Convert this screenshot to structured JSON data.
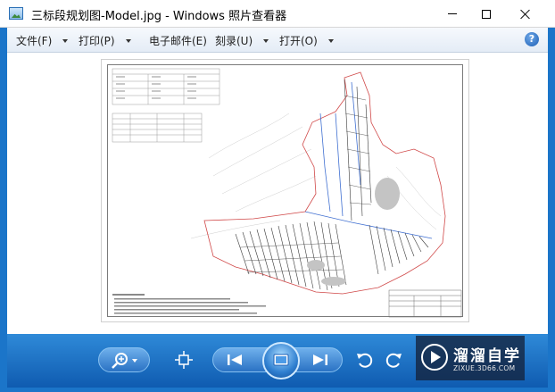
{
  "window": {
    "title": "三标段规划图-Model.jpg - Windows 照片查看器"
  },
  "menu": {
    "items": [
      {
        "label": "文件(F)",
        "has_dropdown": true
      },
      {
        "label": "打印(P)",
        "has_dropdown": true
      },
      {
        "label": "电子邮件(E)",
        "has_dropdown": false
      },
      {
        "label": "刻录(U)",
        "has_dropdown": true
      },
      {
        "label": "打开(O)",
        "has_dropdown": true
      }
    ],
    "help_label": "?"
  },
  "toolbar": {
    "buttons": [
      {
        "name": "zoom-button",
        "icon": "magnifier-icon"
      },
      {
        "name": "actual-size-button",
        "icon": "fit-window-icon"
      },
      {
        "name": "previous-button",
        "icon": "previous-icon"
      },
      {
        "name": "slideshow-button",
        "icon": "slideshow-icon"
      },
      {
        "name": "next-button",
        "icon": "next-icon"
      },
      {
        "name": "rotate-left-button",
        "icon": "rotate-ccw-icon"
      },
      {
        "name": "rotate-right-button",
        "icon": "rotate-cw-icon"
      }
    ]
  },
  "watermark": {
    "title": "溜溜自学",
    "url": "ZIXUE.3D66.COM"
  },
  "colors": {
    "toolbar_blue": "#1b75c9",
    "plan_red": "#d04848",
    "plan_blue": "#3f6fd1"
  }
}
